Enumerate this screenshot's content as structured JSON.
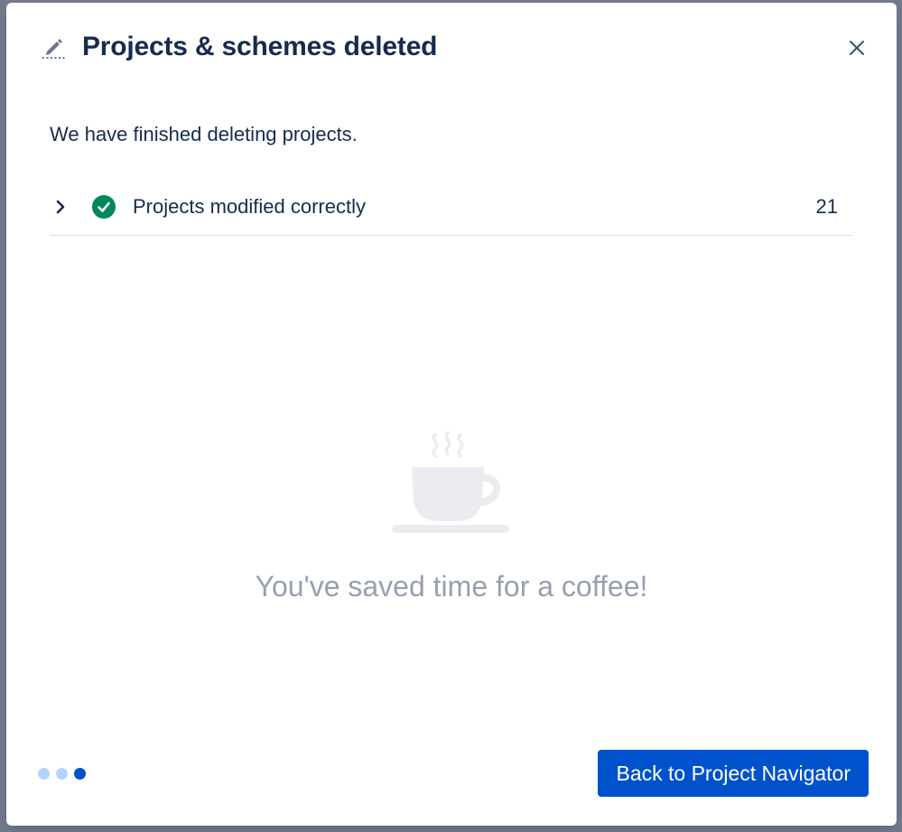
{
  "dialog": {
    "title": "Projects & schemes deleted",
    "intro": "We have finished deleting projects.",
    "result": {
      "label": "Projects modified correctly",
      "count": "21",
      "status_color": "#00875a"
    },
    "empty_state": {
      "message": "You've saved time for a coffee!",
      "icon": "coffee-cup-icon"
    },
    "steps": {
      "total": 3,
      "current": 3
    },
    "primary_button": "Back to Project Navigator"
  },
  "colors": {
    "accent": "#0052cc",
    "text": "#172b4d",
    "muted": "#97a0af"
  }
}
